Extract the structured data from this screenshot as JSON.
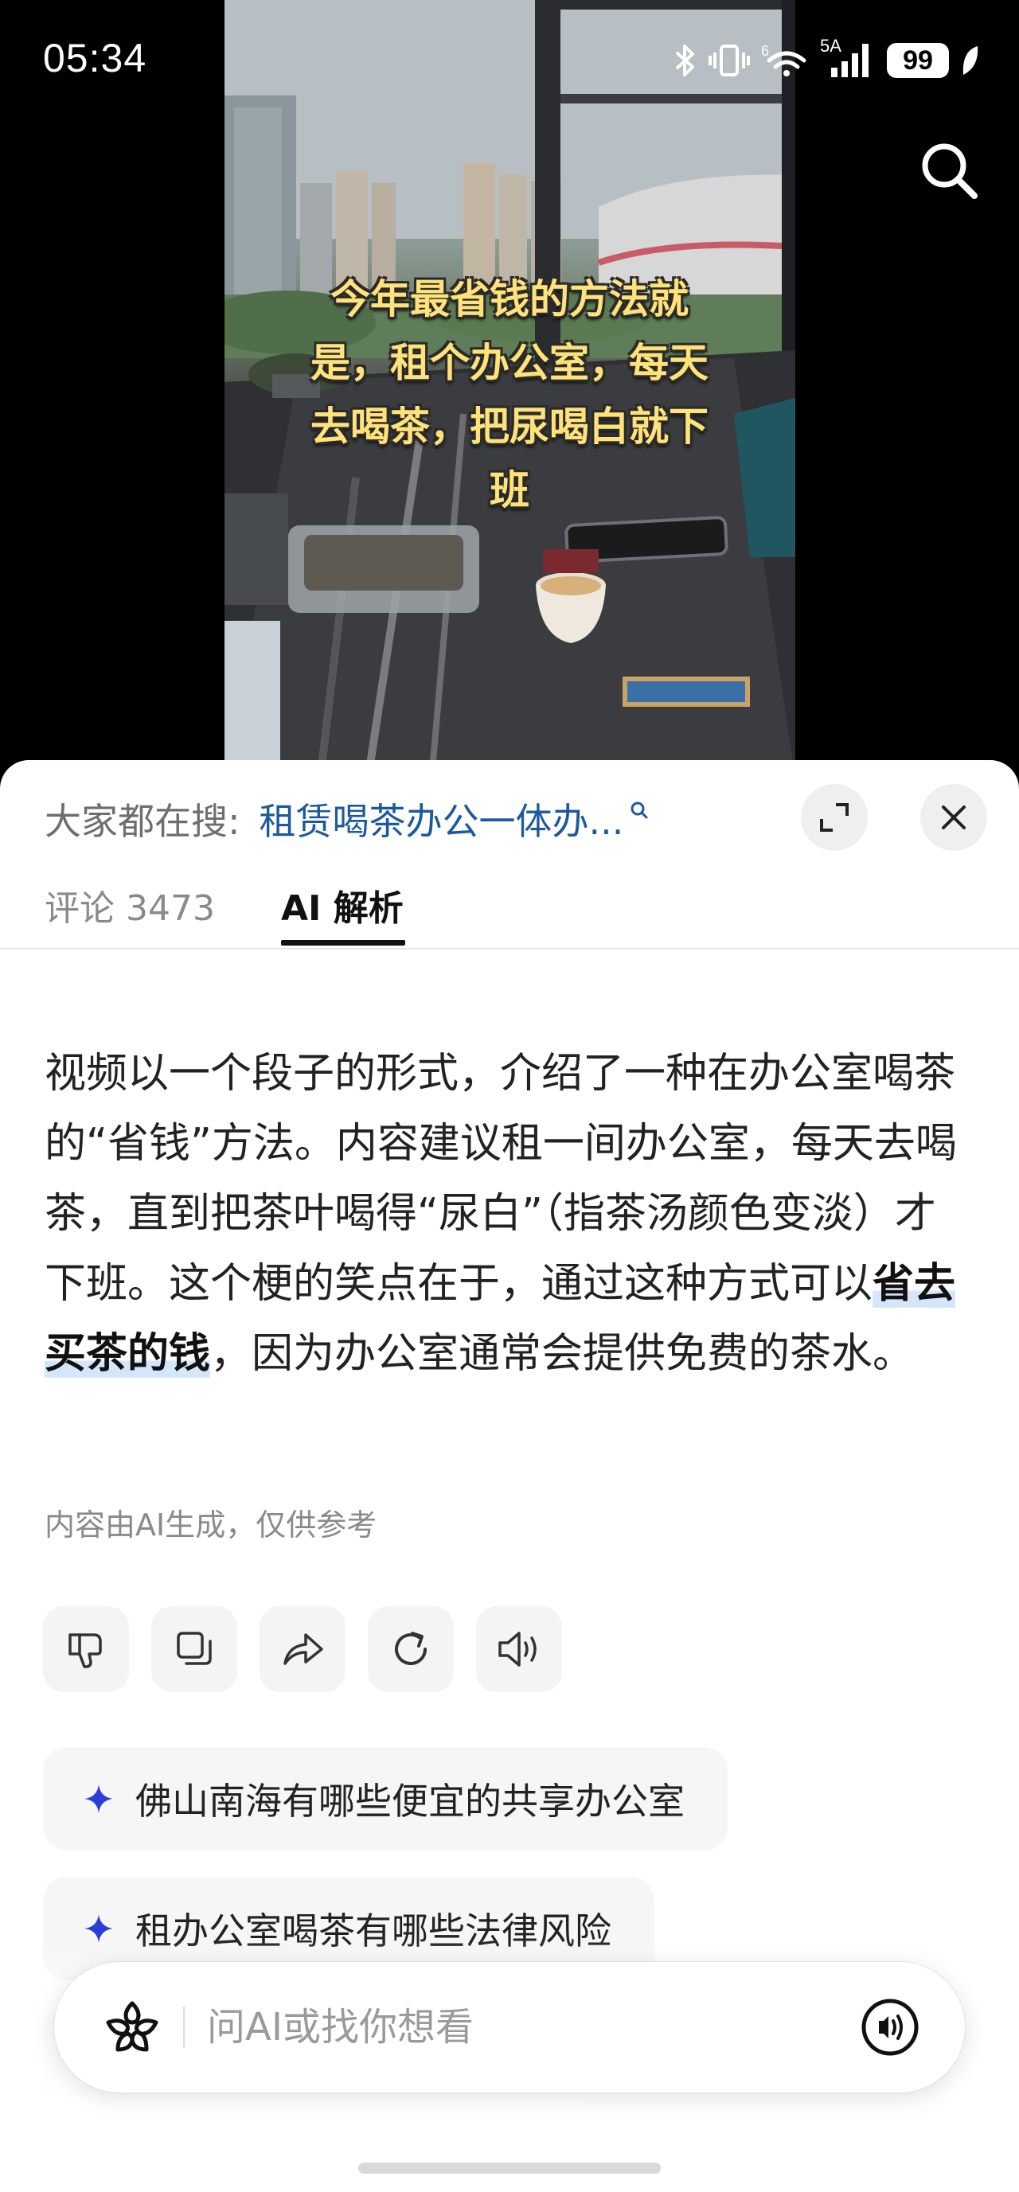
{
  "status_bar": {
    "time": "05:34",
    "network": "5A",
    "battery": "99",
    "icons": [
      "bluetooth-icon",
      "vibrate-icon",
      "wifi-icon",
      "signal-icon",
      "battery-icon",
      "leaf-icon"
    ]
  },
  "video": {
    "caption": "今年最省钱的方法就是，租个办公室，每天去喝茶，把尿喝白就下班",
    "search_icon": "search-icon"
  },
  "sheet": {
    "trending_label": "大家都在搜:",
    "trending_query": "租赁喝茶办公一体办...",
    "expand_icon": "expand-icon",
    "close_icon": "close-icon",
    "tabs": [
      {
        "label": "评论 3473",
        "active": false
      },
      {
        "label": "AI 解析",
        "active": true
      }
    ]
  },
  "ai_summary": {
    "part1": "视频以一个段子的形式，介绍了一种在办公室喝茶的“省钱”方法。内容建议租一间办公室，每天去喝茶，直到把茶叶喝得“尿白”（指茶汤颜色变淡）才下班。这个梗的笑点在于，通过这种方式可以",
    "highlight": "省去买茶的钱",
    "part2": "，因为办公室通常会提供免费的茶水。",
    "disclaimer": "内容由AI生成，仅供参考"
  },
  "actions": [
    "thumbs-down-icon",
    "copy-icon",
    "share-icon",
    "regenerate-icon",
    "speaker-icon"
  ],
  "suggestions": [
    {
      "text": "佛山南海有哪些便宜的共享办公室"
    },
    {
      "text": "租办公室喝茶有哪些法律风险"
    },
    {
      "text": ""
    }
  ],
  "ask_bar": {
    "placeholder": "问AI或找你想看",
    "logo_icon": "ai-flower-logo-icon",
    "voice_icon": "voice-call-icon"
  },
  "colors": {
    "link_blue": "#1d5a9b",
    "caption_yellow": "#ffe27a",
    "highlight_bg": "#d6e6fa",
    "sparkle_blue": "#2a3fd6"
  }
}
